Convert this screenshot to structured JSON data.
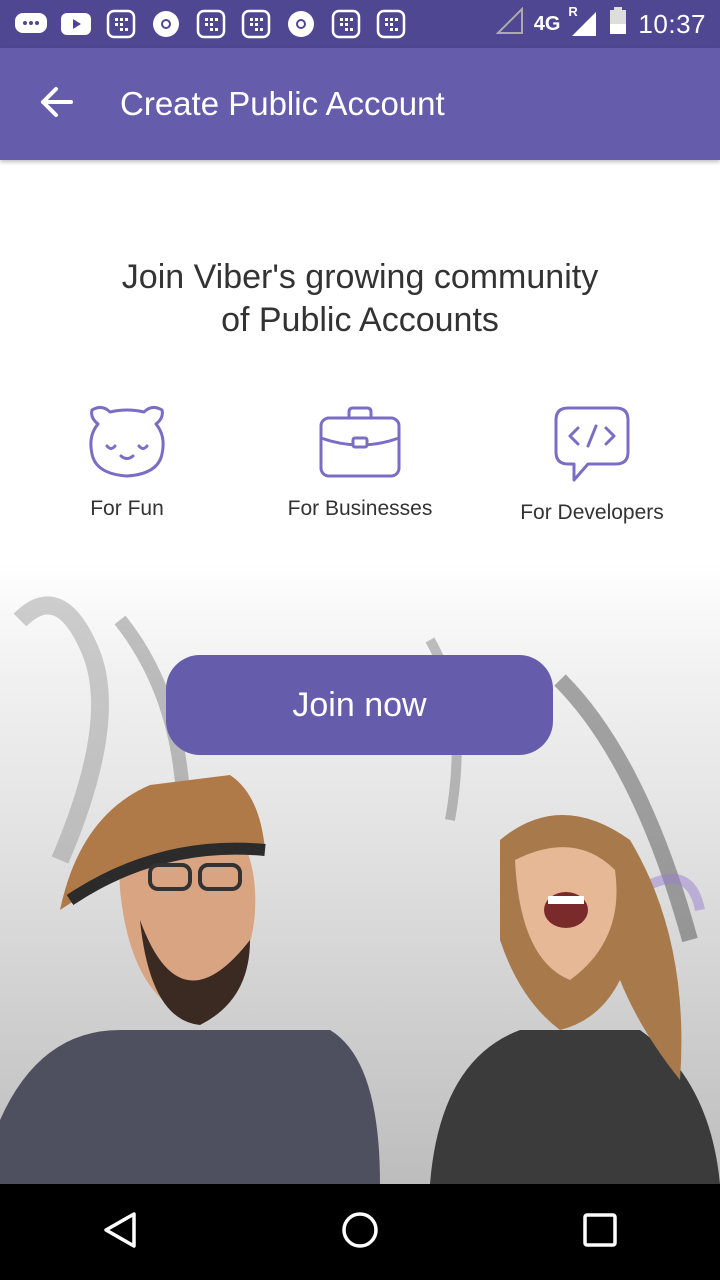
{
  "status_bar": {
    "network": "4G",
    "roaming": "R",
    "time": "10:37",
    "notification_icons": [
      "chat-bubble-icon",
      "youtube-icon",
      "app-grid-icon",
      "chrome-icon",
      "app-grid-icon",
      "app-grid-icon",
      "chrome-icon",
      "app-grid-icon",
      "app-grid-icon"
    ]
  },
  "app_bar": {
    "title": "Create Public Account",
    "back_icon": "arrow-left-icon"
  },
  "main": {
    "headline_line1": "Join Viber's growing community",
    "headline_line2": "of Public Accounts",
    "features": [
      {
        "label": "For Fun",
        "icon": "bear-face-icon"
      },
      {
        "label": "For Businesses",
        "icon": "briefcase-icon"
      },
      {
        "label": "For Developers",
        "icon": "code-bubble-icon"
      }
    ],
    "join_button": "Join now"
  },
  "colors": {
    "accent": "#665cac",
    "status_bar": "#4f4791",
    "text": "#333333"
  }
}
